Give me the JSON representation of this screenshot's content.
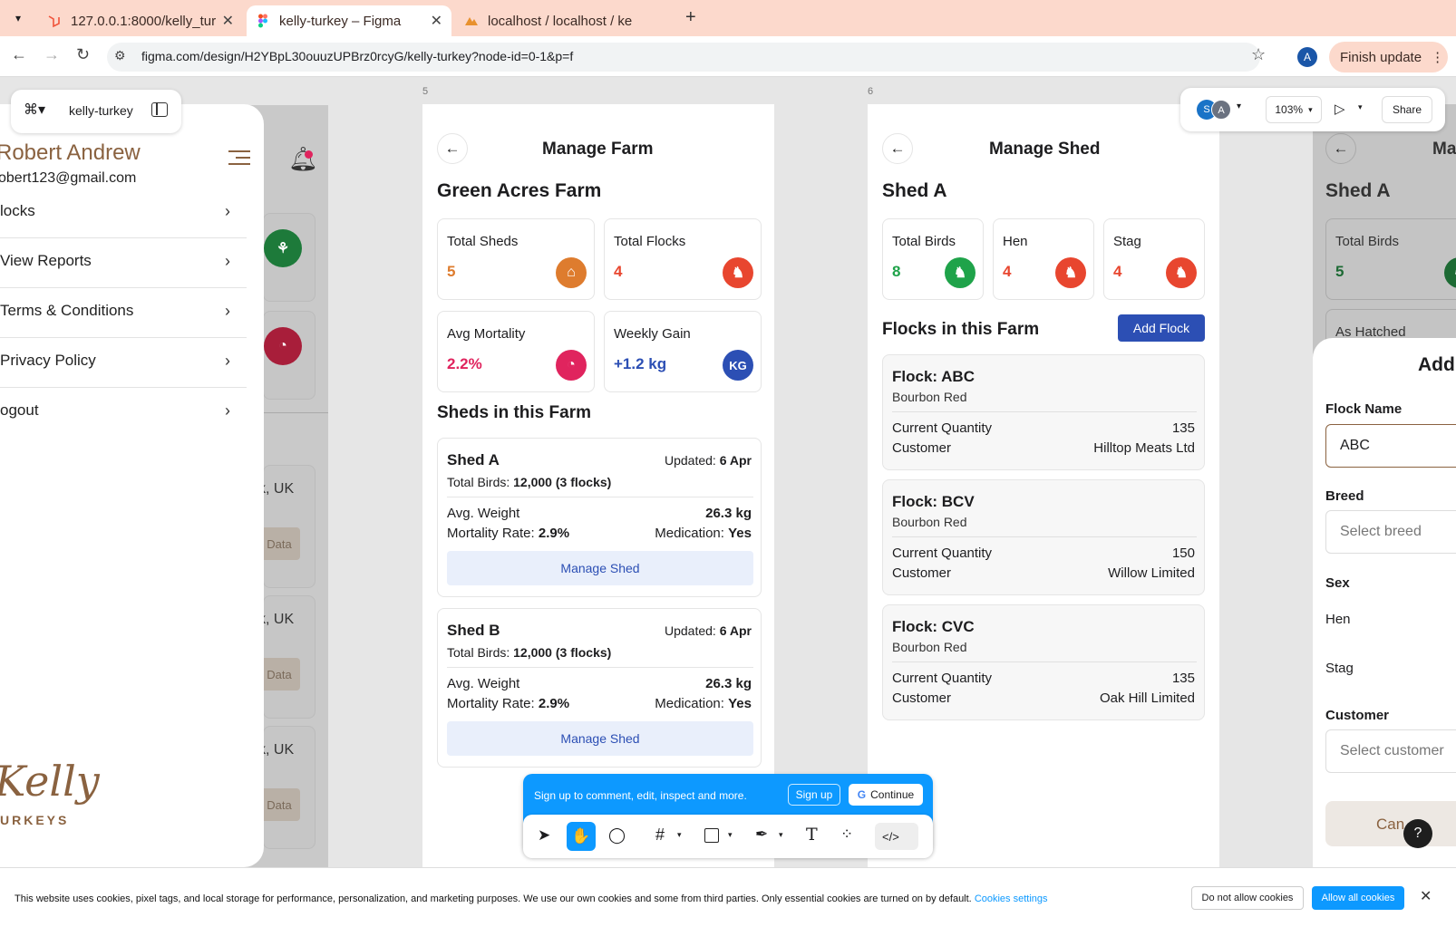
{
  "browser": {
    "tabs": [
      {
        "title": "127.0.0.1:8000/kelly_tur"
      },
      {
        "title": "kelly-turkey – Figma"
      },
      {
        "title": "localhost / localhost / ke"
      }
    ],
    "new_tab": "+",
    "url": "figma.com/design/H2YBpL30ouuzUPBrz0rcyG/kelly-turkey?node-id=0-1&p=f",
    "profile_initial": "A",
    "finish_update": "Finish update"
  },
  "figma": {
    "file_name": "kelly-turkey",
    "zoom": "103%",
    "share": "Share",
    "avatars": [
      "S",
      "A"
    ],
    "frame_labels": [
      "5",
      "6"
    ],
    "signup_banner": {
      "text": "Sign up to comment, edit, inspect and more.",
      "signup": "Sign up",
      "continue": "Continue"
    }
  },
  "drawer": {
    "name": "Robert Andrew",
    "email": "obert123@gmail.com",
    "items": [
      "locks",
      "View Reports",
      "Terms & Conditions",
      "Privacy Policy",
      "ogout"
    ],
    "logo_main": "Kelly",
    "logo_sub": "URKEYS",
    "bg_labels": [
      "k, UK",
      "k, UK",
      "k, UK"
    ],
    "bg_buttons": [
      "Data",
      "Data",
      "Data"
    ]
  },
  "farm": {
    "title": "Manage Farm",
    "farm_name": "Green Acres Farm",
    "stats": [
      {
        "label": "Total Sheds",
        "value": "5",
        "icon": "barn-icon",
        "color": "#de7c2e"
      },
      {
        "label": "Total Flocks",
        "value": "4",
        "icon": "turkey-icon",
        "color": "#e8462f"
      },
      {
        "label": "Avg Mortality",
        "value": "2.2%",
        "icon": "pie-icon",
        "color": "#e0245e"
      },
      {
        "label": "Weekly Gain",
        "value": "+1.2 kg",
        "icon": "kg-icon",
        "color": "#2c4fb4"
      }
    ],
    "kg_glyph": "KG",
    "sheds_heading": "Sheds in this Farm",
    "sheds": [
      {
        "name": "Shed A",
        "updated_label": "Updated:",
        "updated": "6 Apr",
        "total_label": "Total Birds:",
        "total": "12,000 (3 flocks)",
        "weight_label": "Avg. Weight",
        "weight": "26.3 kg",
        "mort_label": "Mortality Rate:",
        "mort": "2.9%",
        "med_label": "Medication:",
        "med": "Yes",
        "button": "Manage Shed"
      },
      {
        "name": "Shed B",
        "updated_label": "Updated:",
        "updated": "6 Apr",
        "total_label": "Total Birds:",
        "total": "12,000 (3 flocks)",
        "weight_label": "Avg. Weight",
        "weight": "26.3 kg",
        "mort_label": "Mortality Rate:",
        "mort": "2.9%",
        "med_label": "Medication:",
        "med": "Yes",
        "button": "Manage Shed"
      }
    ]
  },
  "shed": {
    "title": "Manage Shed",
    "shed_name": "Shed A",
    "stats": [
      {
        "label": "Total Birds",
        "value": "8",
        "color": "#1fa34a"
      },
      {
        "label": "Hen",
        "value": "4",
        "color": "#e8462f"
      },
      {
        "label": "Stag",
        "value": "4",
        "color": "#e8462f"
      }
    ],
    "flocks_heading": "Flocks in this Farm",
    "add_flock": "Add Flock",
    "flocks": [
      {
        "name": "Flock: ABC",
        "breed": "Bourbon Red",
        "qty_label": "Current Quantity",
        "qty": "135",
        "cust_label": "Customer",
        "cust": "Hilltop Meats Ltd"
      },
      {
        "name": "Flock: BCV",
        "breed": "Bourbon Red",
        "qty_label": "Current Quantity",
        "qty": "150",
        "cust_label": "Customer",
        "cust": "Willow Limited"
      },
      {
        "name": "Flock: CVC",
        "breed": "Bourbon Red",
        "qty_label": "Current Quantity",
        "qty": "135",
        "cust_label": "Customer",
        "cust": "Oak Hill Limited"
      }
    ]
  },
  "frame7": {
    "title": "Ma",
    "shed_name": "Shed A",
    "stat_label": "Total Birds",
    "stat_value": "5",
    "as_hatched": "As Hatched",
    "modal": {
      "title": "Add",
      "flock_name_label": "Flock Name",
      "flock_name_value": "ABC",
      "breed_label": "Breed",
      "breed_placeholder": "Select breed",
      "sex_label": "Sex",
      "sex_options": [
        "Hen",
        "Stag"
      ],
      "customer_label": "Customer",
      "customer_placeholder": "Select customer",
      "cancel": "Can"
    }
  },
  "help": "?",
  "cookie": {
    "text": "This website uses cookies, pixel tags, and local storage for performance, personalization, and marketing purposes. We use our own cookies and some from third parties. Only essential cookies are turned on by default.",
    "settings": "Cookies settings",
    "deny": "Do not allow cookies",
    "allow": "Allow all cookies"
  }
}
